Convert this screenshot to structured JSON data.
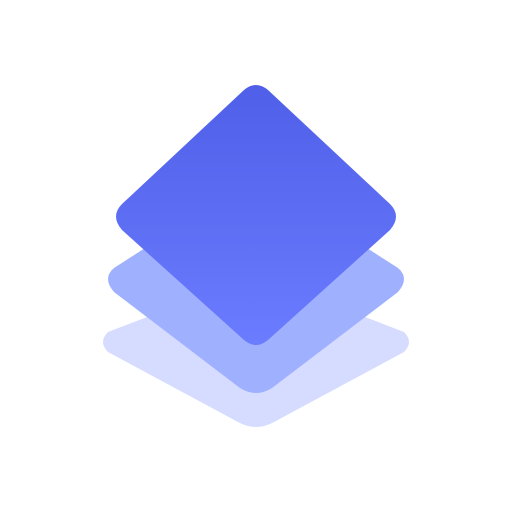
{
  "icon": {
    "name": "stacked-layers-icon",
    "layer_count": 3,
    "colors": {
      "background": "#ffffff",
      "top_layer_start": "#4f5fe8",
      "top_layer_end": "#6b7cff",
      "middle_layer": "#9fb0ff",
      "bottom_layer": "#d5dcff"
    }
  }
}
